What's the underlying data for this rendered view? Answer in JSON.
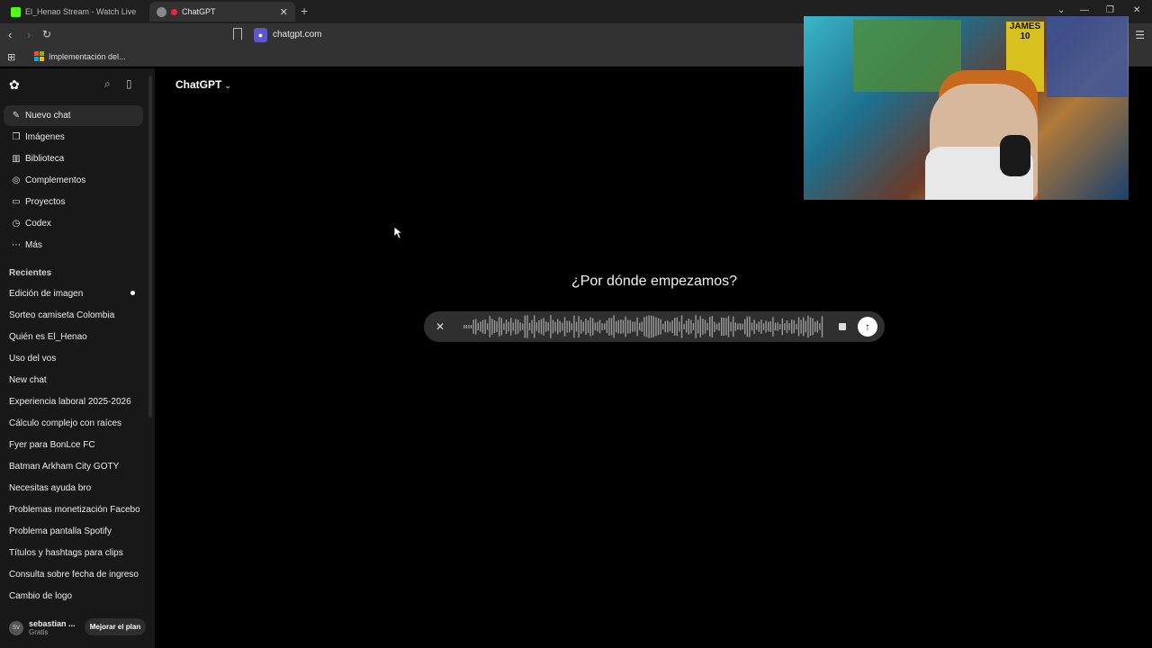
{
  "browser": {
    "tabs": [
      {
        "title": "El_Henao Stream - Watch Live on Kick",
        "active": false
      },
      {
        "title": "ChatGPT",
        "active": true
      }
    ],
    "url": "chatgpt.com",
    "bookmark": "Implementación del..."
  },
  "sidebar": {
    "nav": [
      {
        "label": "Nuevo chat",
        "icon": "edit-icon"
      },
      {
        "label": "Imágenes",
        "icon": "images-icon"
      },
      {
        "label": "Biblioteca",
        "icon": "library-icon"
      },
      {
        "label": "Complementos",
        "icon": "plugins-icon"
      },
      {
        "label": "Proyectos",
        "icon": "folder-icon"
      },
      {
        "label": "Codex",
        "icon": "codex-icon"
      },
      {
        "label": "Más",
        "icon": "more-icon"
      }
    ],
    "recent_heading": "Recientes",
    "recent": [
      "Edición de imagen",
      "Sorteo camiseta Colombia",
      "Quién es El_Henao",
      "Uso del vos",
      "New chat",
      "Experiencia laboral 2025-2026",
      "Cálculo complejo con raíces",
      "Fyer para BonLce FC",
      "Batman Arkham City GOTY",
      "Necesitas ayuda bro",
      "Problemas monetización Facebo...",
      "Problema pantalla Spotify",
      "Títulos y hashtags para clips",
      "Consulta sobre fecha de ingreso",
      "Cambio de logo"
    ],
    "user": {
      "initials": "SV",
      "name": "sebastian ...",
      "plan": "Gratis"
    },
    "upgrade_label": "Mejorar el plan"
  },
  "main": {
    "model": "ChatGPT",
    "heading": "¿Por dónde empezamos?"
  },
  "webcam": {
    "poster_text": "JAMES 10"
  }
}
